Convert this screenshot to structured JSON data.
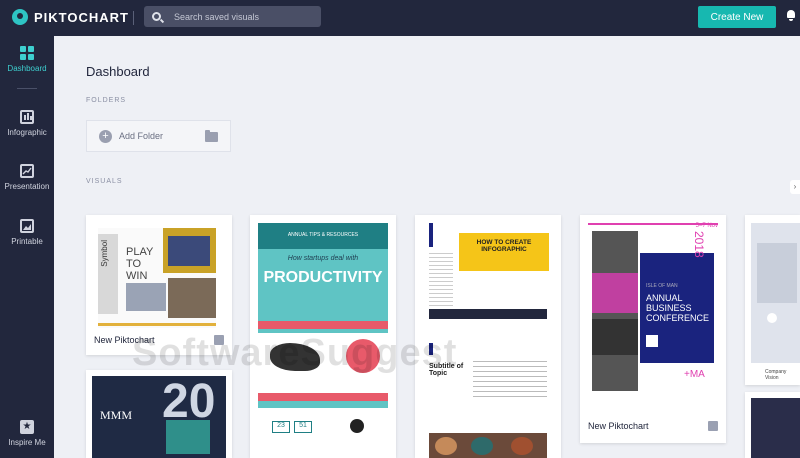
{
  "app": {
    "logo_text": "PIKTOCHART"
  },
  "topbar": {
    "search_placeholder": "Search saved visuals",
    "create_label": "Create New"
  },
  "sidebar": {
    "items": [
      {
        "label": "Dashboard",
        "icon": "grid-icon"
      },
      {
        "label": "Infographic",
        "icon": "infographic-icon"
      },
      {
        "label": "Presentation",
        "icon": "chart-line-icon"
      },
      {
        "label": "Printable",
        "icon": "image-icon"
      },
      {
        "label": "Inspire Me",
        "icon": "star-icon"
      }
    ]
  },
  "main": {
    "title": "Dashboard",
    "folders_label": "FOLDERS",
    "add_folder_label": "Add Folder",
    "visuals_label": "VISUALS"
  },
  "cards": [
    {
      "title": "New Piktochart",
      "preview": {
        "headline": "PLAY TO WIN",
        "side_text": "Symbol"
      }
    },
    {
      "preview": {
        "banner": "ANNUAL TIPS & RESOURCES",
        "subtitle": "How startups deal with",
        "headline": "PRODUCTIVITY",
        "stat1": "23",
        "stat2": "51"
      }
    },
    {
      "preview": {
        "headline": "HOW TO CREATE INFOGRAPHIC",
        "subtitle_heading": "Subtitle of Topic"
      }
    },
    {
      "title": "New Piktochart",
      "preview": {
        "year": "2018",
        "dates": "5–7 Nov",
        "line1": "ANNUAL",
        "line2": "BUSINESS",
        "line3": "CONFERENCE",
        "plus": "+MA",
        "badge": "ISLE OF MAN"
      }
    },
    {
      "preview": {
        "caption": "Company Vision"
      }
    },
    {
      "preview": {
        "headline": "MMM",
        "number": "20"
      }
    }
  ],
  "watermark": "SoftwareSuggest",
  "colors": {
    "topbar": "#22273d",
    "accent": "#17b8b0",
    "background": "#eef0f5",
    "productivity_teal": "#5fc4c4",
    "productivity_red": "#e85a6a",
    "infographic_yellow": "#f5c518",
    "conference_navy": "#1a237e",
    "conference_pink": "#e040b0"
  }
}
